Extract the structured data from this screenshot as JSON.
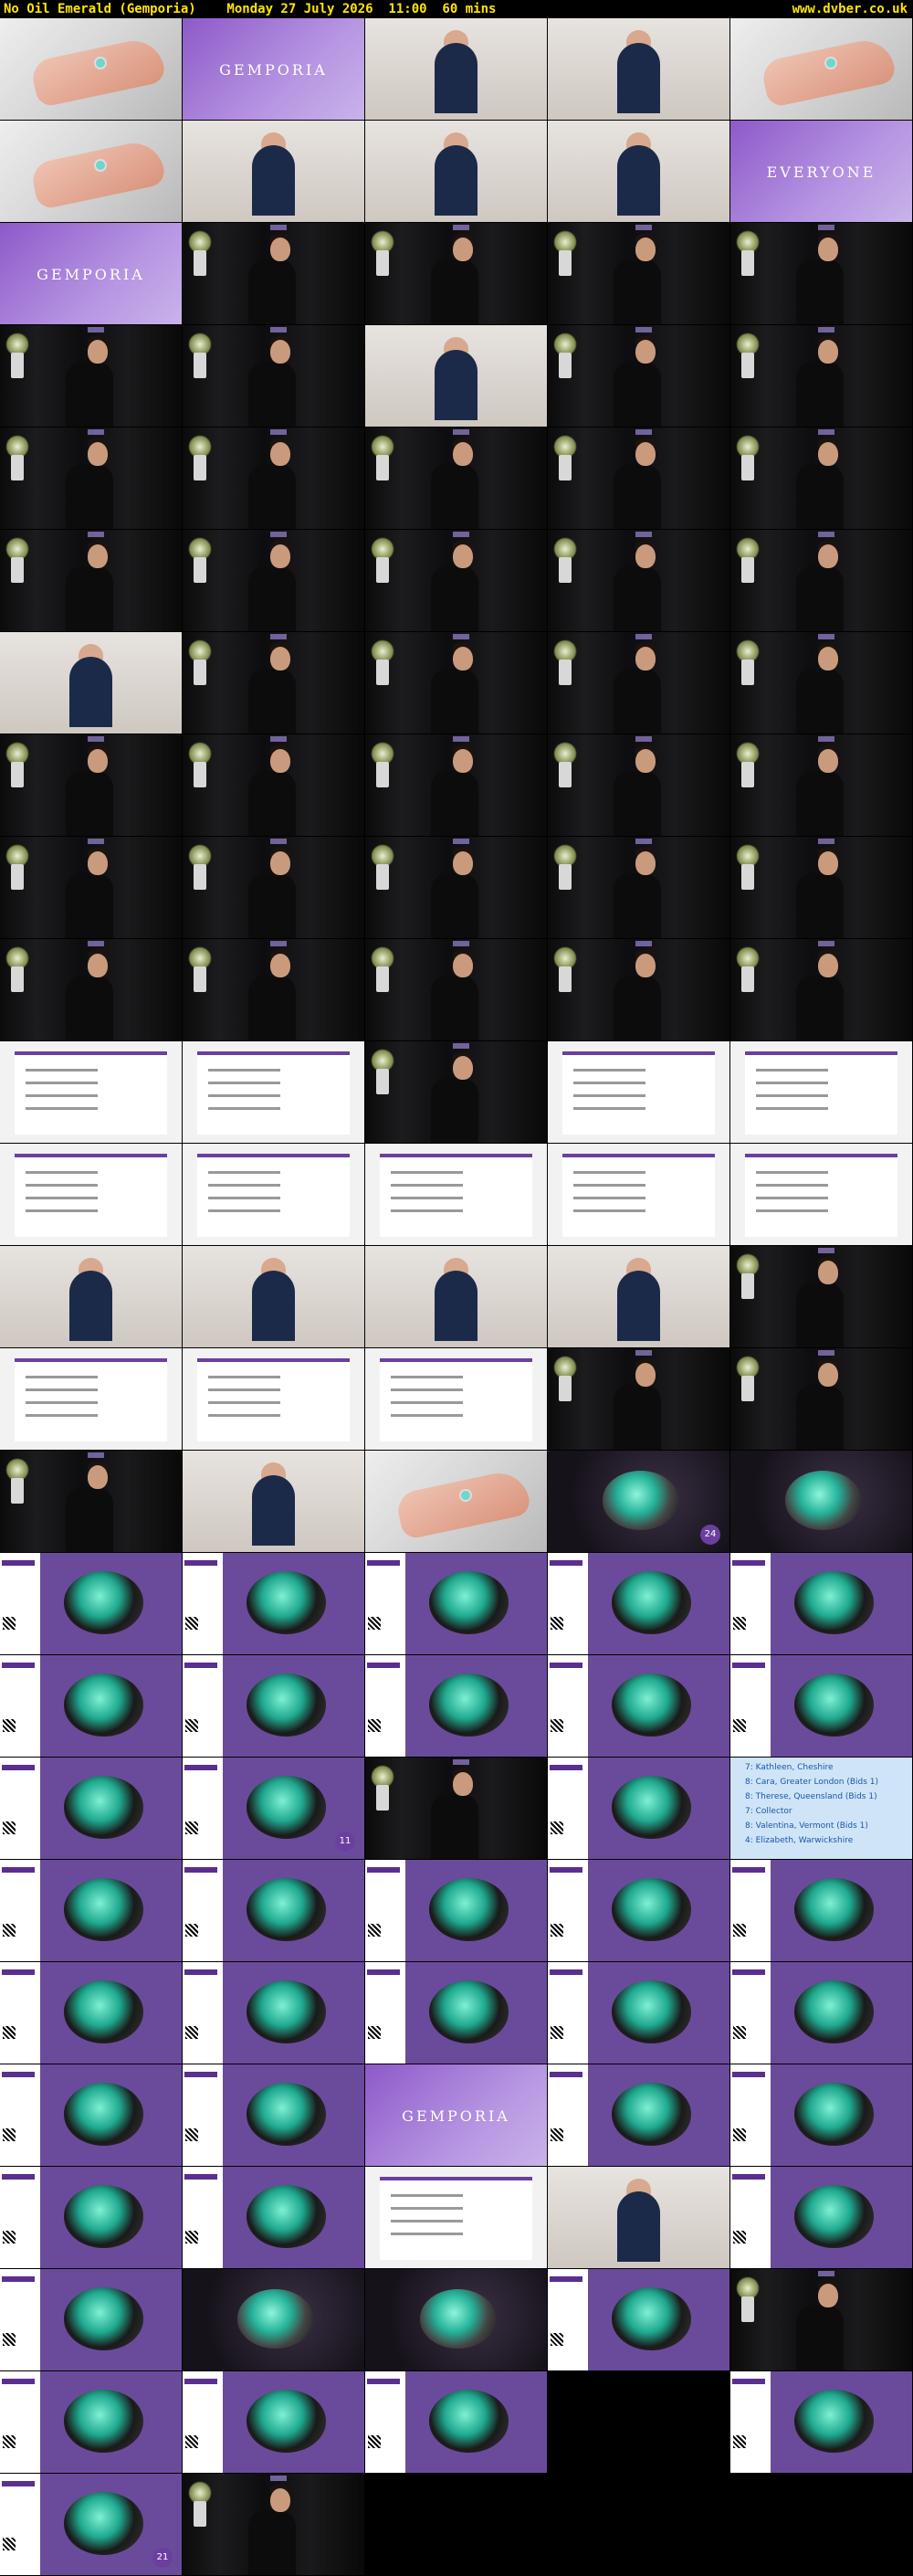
{
  "header": {
    "title": "No Oil Emerald (Gemporia)    Monday 27 July 2026  11:00  60 mins",
    "site": "www.dvber.co.uk"
  },
  "brand_word": "GEMPORIA",
  "everyone_label": "EVERYONE",
  "colors": {
    "header_text": "#ffe600",
    "brand_purple": "#6b3fa0"
  },
  "thumb_badges": [
    "24",
    "11",
    "21"
  ],
  "bid_list": [
    "7: Kathleen, Cheshire",
    "8: Cara, Greater London (Bids 1)",
    "8: Therese, Queensland (Bids 1)",
    "7: Collector",
    "8: Valentina, Vermont (Bids 1)",
    "4: Elizabeth, Warwickshire"
  ],
  "thumbnails": [
    [
      "hand",
      "brand",
      "shelf",
      "shelf",
      "jewel"
    ],
    [
      "jewel",
      "shelf",
      "shelf",
      "shelf",
      "brand-everyone"
    ],
    [
      "brand",
      "studio",
      "studio",
      "studio",
      "studio"
    ],
    [
      "studio",
      "studio",
      "lab",
      "studio",
      "studio"
    ],
    [
      "studio",
      "studio",
      "studio",
      "studio",
      "studio"
    ],
    [
      "studio",
      "studio",
      "studio",
      "studio",
      "studio"
    ],
    [
      "lab",
      "studio",
      "studio",
      "studio",
      "studio"
    ],
    [
      "studio",
      "studio",
      "studio",
      "studio",
      "studio"
    ],
    [
      "studio",
      "studio",
      "studio",
      "studio",
      "studio"
    ],
    [
      "studio",
      "studio",
      "studio",
      "studio",
      "studio"
    ],
    [
      "doc",
      "doc",
      "studio",
      "doc",
      "doc"
    ],
    [
      "doc",
      "doc",
      "doc",
      "doc",
      "doc"
    ],
    [
      "shelf",
      "shelf",
      "shelf",
      "shelf",
      "studio"
    ],
    [
      "doc",
      "doc",
      "doc",
      "studio",
      "studio"
    ],
    [
      "studio",
      "shelf",
      "hand",
      "dark-badge24",
      "dark"
    ],
    [
      "panel",
      "panel",
      "panel",
      "panel",
      "panel"
    ],
    [
      "panel",
      "panel",
      "panel",
      "panel",
      "panel"
    ],
    [
      "panel",
      "panel-badge11",
      "studio",
      "panel",
      "list"
    ],
    [
      "panel",
      "panel",
      "panel",
      "panel",
      "panel"
    ],
    [
      "panel",
      "panel",
      "panel",
      "panel",
      "panel"
    ],
    [
      "panel",
      "panel",
      "brand-star",
      "panel",
      "panel"
    ],
    [
      "panel",
      "panel",
      "doc",
      "shelf",
      "panel"
    ],
    [
      "panel",
      "dark",
      "dark",
      "panel",
      "studio"
    ],
    [
      "panel",
      "panel",
      "panel",
      "empty",
      "panel"
    ],
    [
      "panel-badge21",
      "studio",
      "empty",
      "empty",
      "empty"
    ]
  ]
}
